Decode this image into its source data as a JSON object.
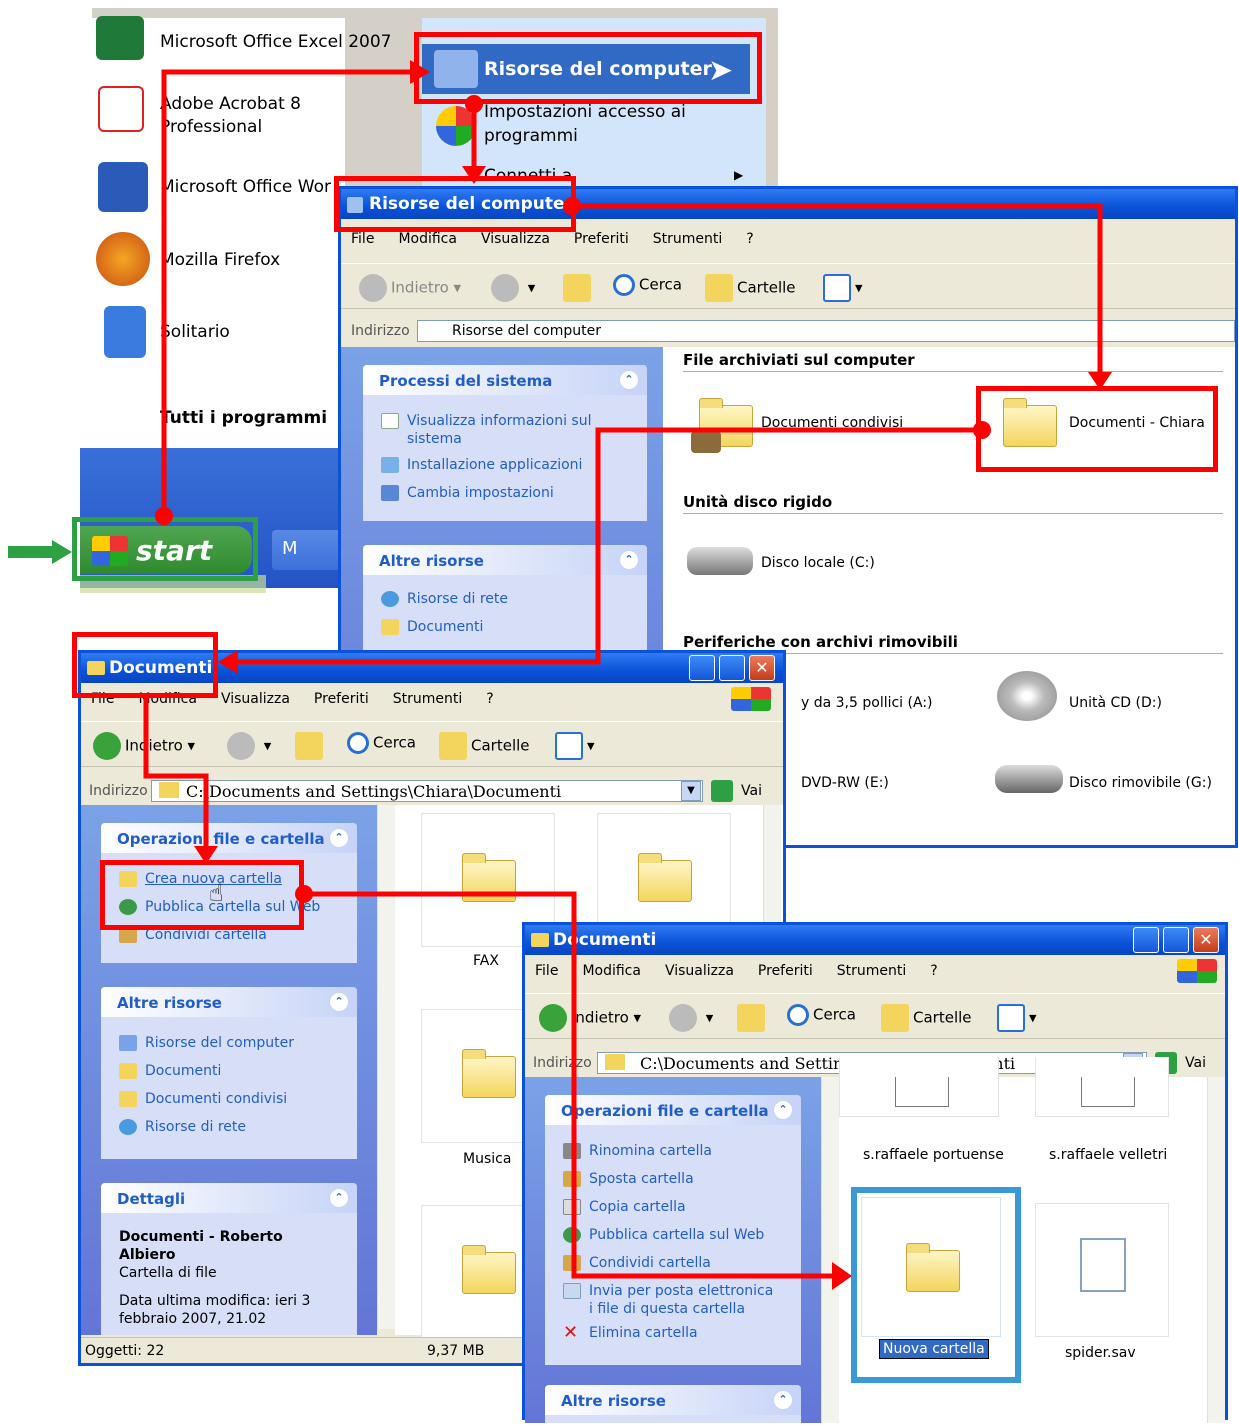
{
  "start_menu": {
    "programs": [
      {
        "label": "Microsoft Office Excel 2007"
      },
      {
        "label": "Adobe Acrobat 8",
        "label2": "Professional"
      },
      {
        "label": "Microsoft Office Wor"
      },
      {
        "label": "Mozilla Firefox"
      },
      {
        "label": "Solitario"
      }
    ],
    "all_programs": "Tutti i programmi",
    "right_items": {
      "my_computer": "Risorse del computer",
      "program_access": "Impostazioni accesso ai",
      "program_access2": "programmi",
      "connect": "Connetti a"
    },
    "start_label": "start",
    "taskbar_item": "M"
  },
  "window_computer": {
    "title": "Risorse del computer",
    "menu": [
      "File",
      "Modifica",
      "Visualizza",
      "Preferiti",
      "Strumenti",
      "?"
    ],
    "toolbar": {
      "back": "Indietro",
      "search": "Cerca",
      "folders": "Cartelle"
    },
    "address_label": "Indirizzo",
    "address_value": "Risorse del computer",
    "panel_system": {
      "title": "Processi del sistema",
      "items": [
        "Visualizza informazioni sul",
        "sistema",
        "Installazione applicazioni",
        "Cambia impostazioni"
      ]
    },
    "panel_other": {
      "title": "Altre risorse",
      "items": [
        "Risorse di rete",
        "Documenti"
      ]
    },
    "sections": {
      "stored": "File archiviati sul computer",
      "hard_disks": "Unità disco rigido",
      "removable": "Periferiche con archivi rimovibili"
    },
    "items": {
      "shared_docs": "Documenti condivisi",
      "chiara_docs": "Documenti - Chiara",
      "local_disk": "Disco locale (C:)",
      "floppy": "y da 3,5 pollici (A:)",
      "cd": "Unità CD (D:)",
      "dvd": "DVD-RW (E:)",
      "removable_disk": "Disco rimovibile (G:)"
    }
  },
  "window_docs1": {
    "title": "Documenti",
    "menu": [
      "File",
      "Modifica",
      "Visualizza",
      "Preferiti",
      "Strumenti",
      "?"
    ],
    "toolbar": {
      "back": "Indietro",
      "search": "Cerca",
      "folders": "Cartelle"
    },
    "address_label": "Indirizzo",
    "address_value": "C:\\Documents and Settings\\Chiara\\Documenti",
    "go": "Vai",
    "panel_ops": {
      "title": "Operazioni file e cartella",
      "items": [
        "Crea nuova cartella",
        "Pubblica cartella sul Web",
        "Condividi cartella"
      ]
    },
    "panel_other": {
      "title": "Altre risorse",
      "items": [
        "Risorse del computer",
        "Documenti",
        "Documenti condivisi",
        "Risorse di rete"
      ]
    },
    "panel_details": {
      "title": "Dettagli",
      "name": "Documenti - Roberto",
      "name2": "Albiero",
      "type": "Cartella di file",
      "modified": "Data ultima modifica: ieri 3",
      "modified2": "febbraio 2007, 21.02"
    },
    "folders": [
      "FAX",
      "Musica"
    ],
    "status_objects": "Oggetti: 22",
    "status_size": "9,37 MB"
  },
  "window_docs2": {
    "title": "Documenti",
    "menu": [
      "File",
      "Modifica",
      "Visualizza",
      "Preferiti",
      "Strumenti",
      "?"
    ],
    "toolbar": {
      "back": "Indietro",
      "search": "Cerca",
      "folders": "Cartelle"
    },
    "address_label": "Indirizzo",
    "address_value": "C:\\Documents and Settings\\Chiara\\Documenti",
    "go": "Vai",
    "panel_ops": {
      "title": "Operazioni file e cartella",
      "items": [
        "Rinomina cartella",
        "Sposta cartella",
        "Copia cartella",
        "Pubblica cartella sul Web",
        "Condividi cartella",
        "Invia per posta elettronica",
        "i file di questa cartella",
        "Elimina cartella"
      ]
    },
    "panel_other": {
      "title": "Altre risorse"
    },
    "files": [
      "s.raffaele portuense",
      "s.raffaele velletri",
      "Nuova cartella",
      "spider.sav"
    ]
  },
  "colors": {
    "accent": "#0a52d8",
    "highlight": "#ff0000",
    "start_green": "#2ca042"
  }
}
